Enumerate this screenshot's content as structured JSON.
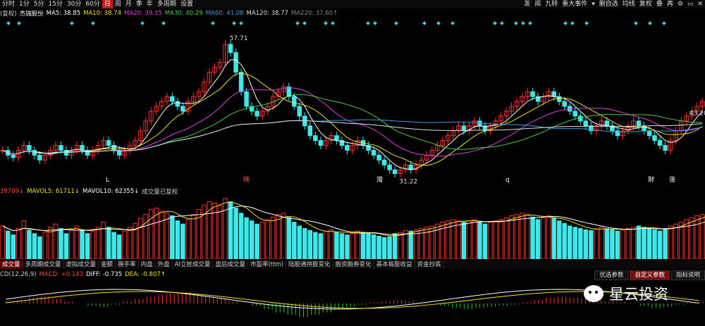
{
  "toolbar": {
    "left": [
      "分时",
      "1分",
      "5分",
      "15分",
      "30分",
      "60分",
      "日",
      "周",
      "月",
      "季",
      "年",
      "多周期",
      "设置"
    ],
    "active": "日",
    "right": [
      "发",
      "闻",
      "九转",
      "重大事件",
      "▾",
      "删自选",
      "均线",
      "复权",
      "叠",
      "再",
      "⚙",
      "▭",
      "✕"
    ]
  },
  "ma_line": {
    "prefix": "(复权)",
    "stock": "杰瑞股份",
    "items": [
      {
        "label": "MA5: 38.85",
        "color": "#ffffff"
      },
      {
        "label": "MA10: 38.74",
        "color": "#f2e21b"
      },
      {
        "label": "MA20: 39.35",
        "color": "#e040e0"
      },
      {
        "label": "MA30: 40.29",
        "color": "#46d046"
      },
      {
        "label": "MA60: 41.06",
        "color": "#3aa0e0"
      },
      {
        "label": "MA120: 38.77",
        "color": "#e0e0e0"
      },
      {
        "label": "MA220: 37.60↑",
        "color": "#888888"
      }
    ]
  },
  "price_labels": {
    "high": "57.71",
    "low": "31.22",
    "right": "43.20"
  },
  "event_markers": [
    "L",
    "晓",
    "灣",
    "q",
    "财",
    "涨"
  ],
  "vol_line": {
    "items": [
      {
        "label": "39709↓",
        "color": "#ff4444"
      },
      {
        "label": "MAVOL5: 61711↓",
        "color": "#f2e21b"
      },
      {
        "label": "MAVOL10: 62355↓",
        "color": "#ffffff"
      },
      {
        "label": "成交量已复权",
        "color": "#cccccc"
      }
    ]
  },
  "tabs": [
    "成交量",
    "多周期成交量",
    "虚拟成交量",
    "金额",
    "换手率",
    "内盘",
    "外盘",
    "AI立桩成交量",
    "盘后成交量",
    "市盈率(ttm)",
    "陆股通持股变化",
    "融资融券变化",
    "基本每股收益",
    "资金抄底"
  ],
  "active_tab": "成交量",
  "param_buttons": [
    "优选参数",
    "自定义参数",
    "指标说明"
  ],
  "macd_line": {
    "items": [
      {
        "label": "CD(12,26,9)",
        "color": "#cccccc"
      },
      {
        "label": "MACD: +0.143",
        "color": "#ff4444"
      },
      {
        "label": "DIFF: -0.735",
        "color": "#ffffff"
      },
      {
        "label": "DEA: -0.807↑",
        "color": "#f2e21b"
      }
    ]
  },
  "watermark": "星云投资",
  "chart_data": {
    "type": "candlestick",
    "highest": 57.71,
    "lowest": 31.22,
    "ylim": [
      29,
      60
    ],
    "closes": [
      36,
      35,
      34.5,
      36,
      37,
      36,
      35,
      34,
      35,
      36,
      37,
      36,
      35,
      36,
      37,
      36,
      35,
      36,
      37,
      38,
      37,
      36,
      35,
      36,
      37,
      38,
      40,
      42,
      44,
      45,
      46,
      47,
      46,
      45,
      44,
      46,
      47,
      48,
      50,
      52,
      53,
      54,
      57.71,
      56,
      52,
      48,
      45,
      44,
      43,
      44,
      45,
      47,
      48,
      49,
      47,
      45,
      43,
      41,
      39,
      38,
      37,
      38,
      39,
      38,
      37,
      36,
      37,
      38,
      37,
      36,
      35,
      34,
      33,
      32,
      31.22,
      32,
      33,
      32,
      33,
      34,
      35,
      36,
      37,
      38,
      39,
      40,
      41,
      40,
      41,
      42,
      41,
      40,
      41,
      42,
      43,
      44,
      45,
      46,
      47,
      48,
      47,
      46,
      47,
      48,
      47,
      46,
      45,
      44,
      43,
      42,
      41,
      40,
      41,
      42,
      41,
      40,
      39,
      40,
      41,
      42,
      41,
      40,
      39,
      38,
      37,
      36,
      38,
      40,
      42,
      43,
      44,
      45,
      46
    ],
    "volumes": [
      52,
      44,
      38,
      48,
      60,
      45,
      40,
      35,
      42,
      50,
      55,
      48,
      40,
      45,
      52,
      46,
      40,
      44,
      50,
      58,
      50,
      42,
      38,
      44,
      50,
      56,
      64,
      70,
      78,
      80,
      75,
      72,
      68,
      60,
      55,
      62,
      70,
      78,
      85,
      90,
      88,
      84,
      95,
      90,
      80,
      72,
      65,
      60,
      55,
      58,
      62,
      66,
      70,
      72,
      65,
      58,
      52,
      48,
      45,
      42,
      40,
      44,
      46,
      42,
      40,
      38,
      40,
      44,
      42,
      40,
      38,
      36,
      34,
      35,
      40,
      42,
      45,
      44,
      46,
      48,
      50,
      52,
      55,
      58,
      60,
      62,
      60,
      58,
      60,
      62,
      58,
      55,
      58,
      60,
      62,
      65,
      68,
      70,
      72,
      70,
      66,
      62,
      65,
      68,
      64,
      60,
      56,
      52,
      50,
      48,
      46,
      45,
      47,
      50,
      48,
      46,
      44,
      46,
      48,
      50,
      52,
      50,
      48,
      46,
      44,
      48,
      52,
      55,
      58,
      62,
      65,
      68,
      70,
      72,
      74
    ],
    "macd": [
      0.2,
      0.3,
      0.5,
      0.6,
      0.4,
      0.2,
      0,
      -0.2,
      -0.3,
      -0.1,
      0.2,
      0.4,
      0.6,
      0.8,
      0.9,
      1,
      0.8,
      0.6,
      0.4,
      0.2,
      0,
      -0.2,
      -0.5,
      -0.8,
      -1,
      -1.2,
      -1,
      -0.8,
      -0.5,
      -0.3,
      -0.1,
      0.1,
      0.2,
      0.3,
      0.2,
      0.1,
      0,
      -0.2,
      -0.4,
      -0.5,
      -0.4,
      -0.3,
      -0.2,
      -0.1,
      0.1,
      0.3,
      0.5,
      0.6,
      0.5,
      0.4,
      0.3,
      0.2,
      0.1,
      0,
      -0.2,
      -0.4,
      -0.3,
      -0.1,
      0.1,
      0.143
    ]
  }
}
